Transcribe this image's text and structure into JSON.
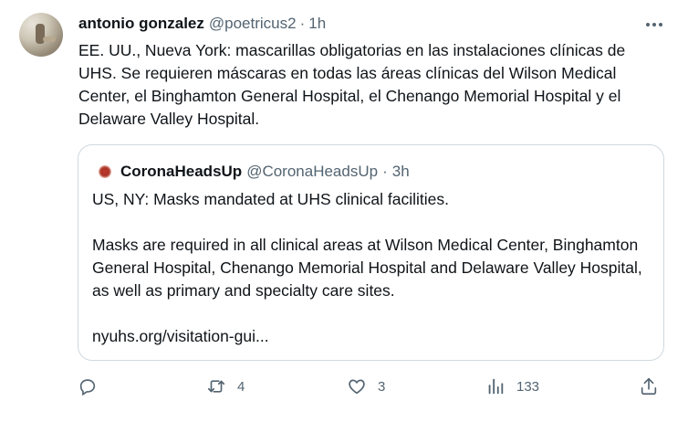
{
  "tweet": {
    "author_name": "antonio gonzalez",
    "author_handle": "@poetricus2",
    "separator": "·",
    "time": "1h",
    "text": "EE. UU., Nueva York: mascarillas obligatorias en las instalaciones clínicas de UHS. Se requieren máscaras en todas las áreas clínicas del Wilson Medical Center, el Binghamton General Hospital, el Chenango Memorial Hospital y el Delaware Valley Hospital."
  },
  "quoted": {
    "author_name": "CoronaHeadsUp",
    "author_handle": "@CoronaHeadsUp",
    "separator": "·",
    "time": "3h",
    "line1": "US, NY: Masks mandated at UHS clinical facilities.",
    "line2": "Masks are required in all clinical areas at Wilson Medical Center, Binghamton General Hospital, Chenango Memorial Hospital and Delaware Valley Hospital, as well as primary and specialty care sites.",
    "link": "nyuhs.org/visitation-gui..."
  },
  "actions": {
    "reply_count": "",
    "retweet_count": "4",
    "like_count": "3",
    "views_count": "133"
  },
  "icons": {
    "more": "more-horizontal-icon",
    "reply": "reply-icon",
    "retweet": "retweet-icon",
    "like": "heart-icon",
    "views": "views-chart-icon",
    "share": "share-icon"
  },
  "colors": {
    "text": "#0f1419",
    "secondary": "#536471",
    "border": "#cfd9de"
  }
}
